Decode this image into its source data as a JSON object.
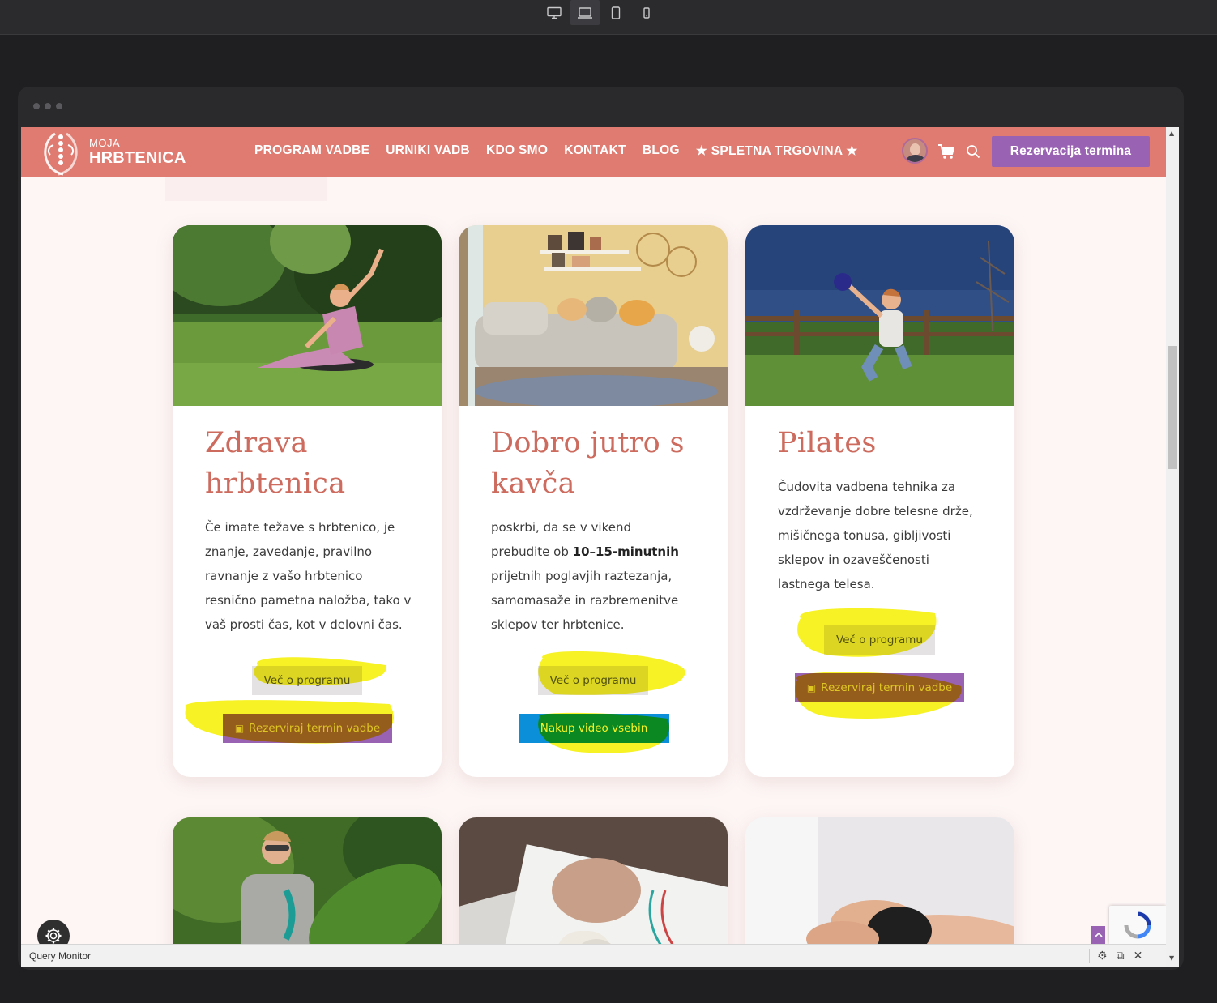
{
  "devices": [
    "desktop-icon",
    "laptop-icon",
    "tablet-icon",
    "mobile-icon"
  ],
  "header": {
    "logo_small": "MOJA",
    "logo_big": "HRBTENICA",
    "nav": [
      "PROGRAM VADBE",
      "URNIKI VADB",
      "KDO SMO",
      "KONTAKT",
      "BLOG",
      "★ SPLETNA TRGOVINA ★"
    ],
    "cta": "Rezervacija termina"
  },
  "cards": [
    {
      "title_line1": "Zdrava",
      "title_line2": "hrbtenica",
      "text": "Če imate težave s hrbtenico, je znanje, zavedanje, pravilno ravnanje z vašo hrbtenico resnično pametna naložba, tako v vaš prosti čas, kot v delovni čas.",
      "more": "Več o programu",
      "reserve": "Rezerviraj termin vadbe"
    },
    {
      "title_line1": "Dobro jutro s",
      "title_line2": "kavča",
      "text_before": "poskrbi, da se v vikend prebudite ob ",
      "text_bold": "10–15-minutnih",
      "text_after": " prijetnih poglavjih raztezanja, samomasaže in razbremenitve sklepov ter hrbtenice.",
      "more": "Več o programu",
      "video": "Nakup video vsebin"
    },
    {
      "title_line1": "Pilates",
      "text": "Čudovita vadbena tehnika za vzdrževanje dobre telesne drže, mišičnega tonusa, gibljivosti sklepov in ozaveščenosti lastnega telesa.",
      "more": "Več o programu",
      "reserve": "Rezerviraj termin vadbe"
    }
  ],
  "colors": {
    "header_bg": "#df7b70",
    "title": "#cd6b5e",
    "purple": "#9a62b2",
    "video_blue": "#0b8fd8",
    "highlight": "#f5f000"
  },
  "query_monitor": {
    "label": "Query Monitor"
  }
}
